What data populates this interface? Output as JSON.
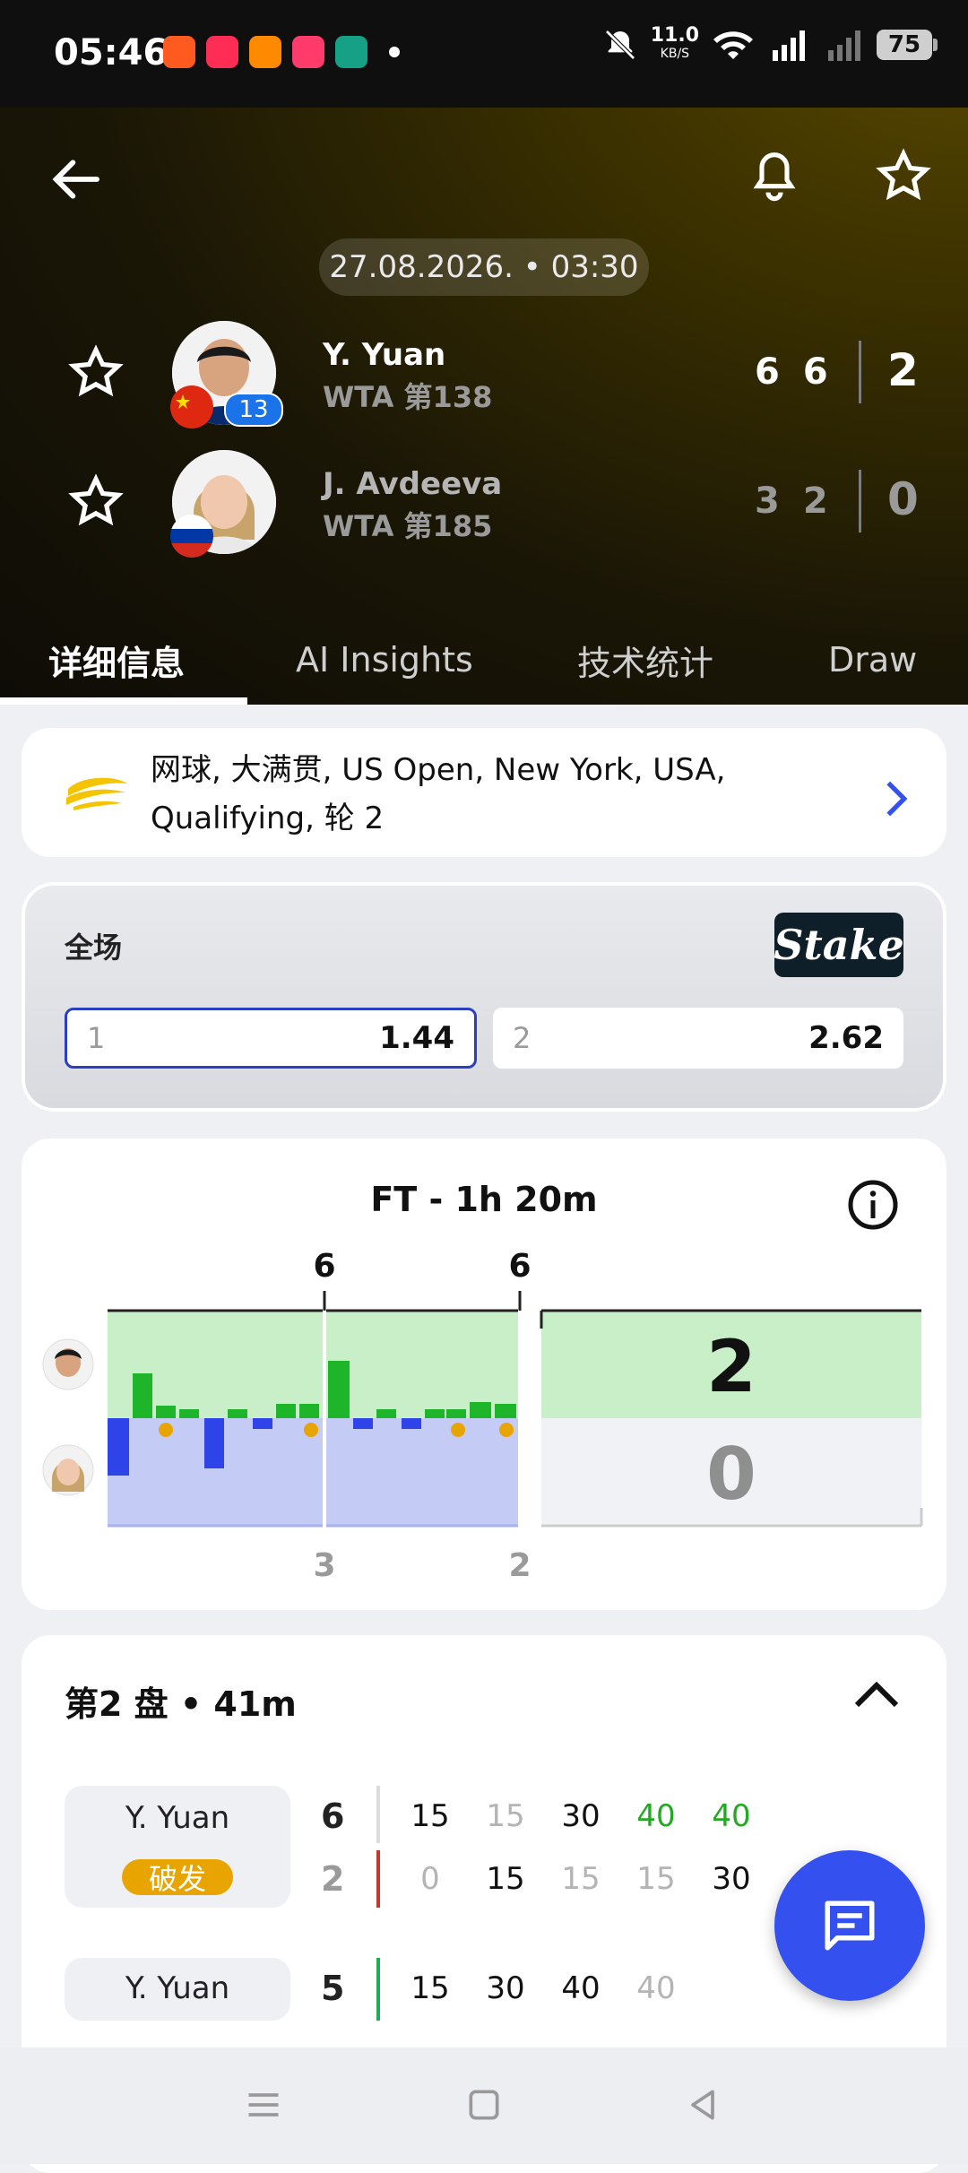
{
  "status_bar": {
    "time": "05:46",
    "net_speed": "11.0",
    "net_unit": "KB/S",
    "battery": "75",
    "app_icon_colors": [
      "#ff5a1f",
      "#ff2d55",
      "#ff8a00",
      "#ff3b6b",
      "#16a085"
    ]
  },
  "header": {
    "date": "27.08.2026. • 03:30",
    "players": [
      {
        "name": "Y. Yuan",
        "rank": "WTA 第138",
        "seed": "13",
        "sets": [
          "6",
          "6"
        ],
        "total": "2"
      },
      {
        "name": "J. Avdeeva",
        "rank": "WTA 第185",
        "seed": "",
        "sets": [
          "3",
          "2"
        ],
        "total": "0"
      }
    ]
  },
  "tabs": [
    "详细信息",
    "AI Insights",
    "技术统计",
    "Draw"
  ],
  "competition": {
    "text_line1": "网球, 大满贯, US Open, New York, USA,",
    "text_line2": "Qualifying, 轮 2"
  },
  "odds": {
    "title": "全场",
    "brand": "Stake",
    "options": [
      {
        "label": "1",
        "value": "1.44"
      },
      {
        "label": "2",
        "value": "2.62"
      }
    ]
  },
  "momentum": {
    "title": "FT - 1h 20m",
    "top_set_scores": [
      "6",
      "6"
    ],
    "bottom_set_scores": [
      "3",
      "2"
    ],
    "total_top": "2",
    "total_bottom": "0"
  },
  "set_detail": {
    "title": "第2 盘 • 41m",
    "break_label": "破发",
    "games": [
      {
        "name": "Y. Yuan",
        "score_top": "6",
        "score_bottom": "2",
        "top_points": [
          "15",
          "15",
          "30",
          "40",
          "40"
        ],
        "bottom_points": [
          "0",
          "15",
          "15",
          "15",
          "30"
        ]
      },
      {
        "name": "Y. Yuan",
        "score_top": "5",
        "top_points": [
          "15",
          "30",
          "40",
          "40"
        ]
      }
    ]
  }
}
